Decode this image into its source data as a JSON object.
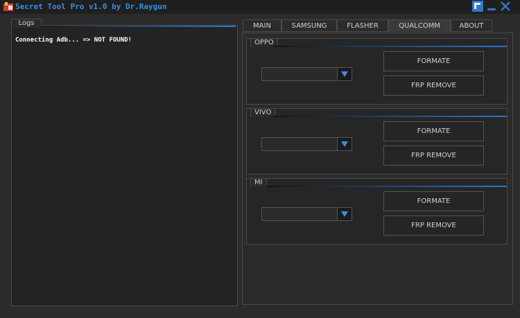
{
  "window": {
    "title": "Secret Tool Pro v1.0 by Dr.Raygun",
    "controls": {
      "restore_icon": "restore-icon",
      "min_label": "_",
      "close_label": "✕"
    }
  },
  "logs": {
    "label": "Logs",
    "lines": [
      "Connecting Adb... => NOT FOUND!"
    ]
  },
  "tabs": [
    {
      "label": "MAIN"
    },
    {
      "label": "SAMSUNG"
    },
    {
      "label": "FLASHER"
    },
    {
      "label": "QUALCOMM",
      "active": true
    },
    {
      "label": "ABOUT"
    }
  ],
  "groups": [
    {
      "label": "OPPO",
      "dropdown_value": "",
      "formate_label": "FORMATE",
      "frp_label": "FRP REMOVE"
    },
    {
      "label": "VIVO",
      "dropdown_value": "",
      "formate_label": "FORMATE",
      "frp_label": "FRP REMOVE"
    },
    {
      "label": "MI",
      "dropdown_value": "",
      "formate_label": "FORMATE",
      "frp_label": "FRP REMOVE"
    }
  ],
  "colors": {
    "accent": "#2f77c9",
    "title": "#3a8fe0",
    "background": "#2b2b2b"
  }
}
